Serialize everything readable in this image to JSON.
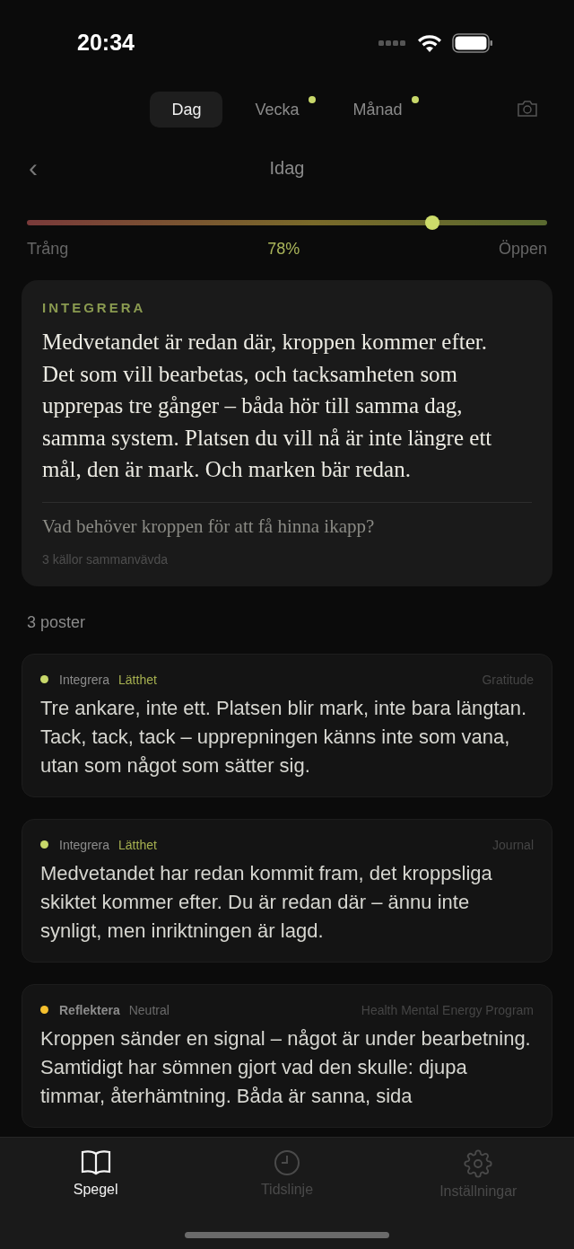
{
  "status_bar": {
    "time": "20:34"
  },
  "period_tabs": [
    {
      "label": "Dag",
      "selected": true,
      "dot": false
    },
    {
      "label": "Vecka",
      "selected": false,
      "dot": true
    },
    {
      "label": "Månad",
      "selected": false,
      "dot": true
    }
  ],
  "nav": {
    "back": "‹",
    "title": "Idag"
  },
  "openness": {
    "left_label": "Trång",
    "reading": "78%",
    "right_label": "Öppen",
    "level": 0.78
  },
  "insight": {
    "category": "INTEGRERA",
    "text": "Medvetandet är redan där, kroppen kommer efter. Det som vill bearbetas, och tacksamheten som upprepas tre gånger – båda hör till samma dag, samma system. Platsen du vill nå är inte längre ett mål, den är mark. Och marken bär redan.",
    "question": "Vad behöver kroppen för att få hinna ikapp?",
    "sources": "3 källor sammanvävda"
  },
  "entries_count": "3 poster",
  "entries": [
    {
      "category": "Integrera",
      "mood": "Lätthet",
      "source": "Gratitude",
      "color": "#c8d86a",
      "text": "Tre ankare, inte ett. Platsen blir mark, inte bara längtan. Tack, tack, tack – upprepningen känns inte som vana, utan som något som sätter sig."
    },
    {
      "category": "Integrera",
      "mood": "Lätthet",
      "source": "Journal",
      "color": "#c8d86a",
      "text": "Medvetandet har redan kommit fram, det kroppsliga skiktet kommer efter. Du är redan där – ännu inte synligt, men inriktningen är lagd."
    },
    {
      "category": "Reflektera",
      "mood": "Neutral",
      "source": "Health Mental Energy Program",
      "color": "#f5c02e",
      "text": "Kroppen sänder en signal – något är under bearbetning. Samtidigt har sömnen gjort vad den skulle: djupa timmar, återhämtning. Båda är sanna, sida"
    }
  ],
  "bottom_tabs": [
    {
      "label": "Spegel",
      "kind": "book",
      "selected": true
    },
    {
      "label": "Tidslinje",
      "kind": "clock",
      "selected": false
    },
    {
      "label": "Inställningar",
      "kind": "gear",
      "selected": false
    }
  ]
}
